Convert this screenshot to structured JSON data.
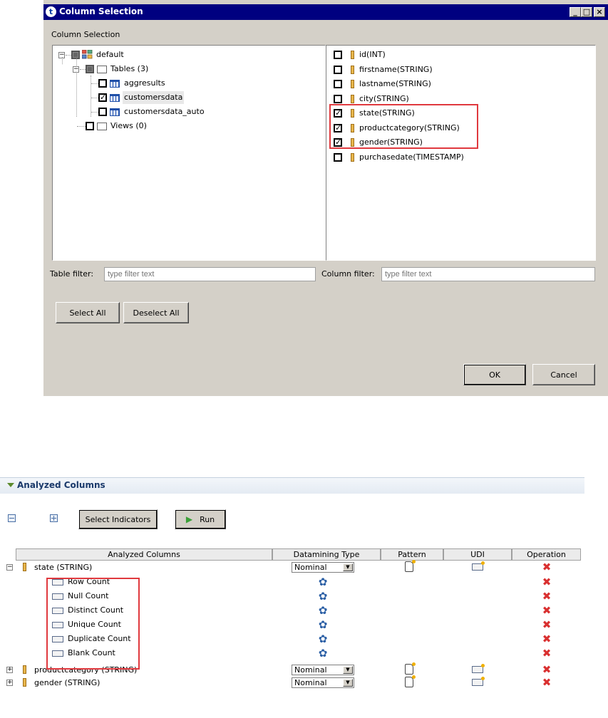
{
  "dialog": {
    "title": "Column Selection",
    "title_icon_glyph": "t",
    "section_label": "Column Selection",
    "window_buttons": {
      "minimize": "_",
      "maximize": "□",
      "close": "×"
    },
    "tree": {
      "root": "default",
      "tables_folder": "Tables (3)",
      "tables": [
        "aggresults",
        "customersdata",
        "customersdata_auto"
      ],
      "views_folder": "Views (0)"
    },
    "columns": [
      {
        "label": "id(INT)",
        "checked": false
      },
      {
        "label": "firstname(STRING)",
        "checked": false
      },
      {
        "label": "lastname(STRING)",
        "checked": false
      },
      {
        "label": "city(STRING)",
        "checked": false
      },
      {
        "label": "state(STRING)",
        "checked": true
      },
      {
        "label": "productcategory(STRING)",
        "checked": true
      },
      {
        "label": "gender(STRING)",
        "checked": true
      },
      {
        "label": "purchasedate(TIMESTAMP)",
        "checked": false
      }
    ],
    "table_filter": {
      "label": "Table filter:",
      "placeholder": "type filter text"
    },
    "column_filter": {
      "label": "Column filter:",
      "placeholder": "type filter text"
    },
    "select_all": "Select All",
    "deselect_all": "Deselect All",
    "ok": "OK",
    "cancel": "Cancel",
    "check_mark": "✓"
  },
  "analyzed": {
    "section_title": "Analyzed Columns",
    "select_indicators": "Select Indicators",
    "run": "Run",
    "headers": {
      "analyzed_columns": "Analyzed Columns",
      "datamining_type": "Datamining Type",
      "pattern": "Pattern",
      "udi": "UDI",
      "operation": "Operation"
    },
    "rows": [
      {
        "name": "state (STRING)",
        "type": "Nominal",
        "expander": "−"
      },
      {
        "name": "productcategory (STRING)",
        "type": "Nominal",
        "expander": "+"
      },
      {
        "name": "gender (STRING)",
        "type": "Nominal",
        "expander": "+"
      }
    ],
    "indicators": [
      "Row Count",
      "Null Count",
      "Distinct Count",
      "Unique Count",
      "Duplicate Count",
      "Blank Count"
    ],
    "glyphs": {
      "delete": "✖",
      "gear": "✿",
      "dropdown": "▼",
      "collapse": "⊟",
      "expand": "⊞"
    }
  },
  "colors": {
    "highlight_red": "#e0393e",
    "title_bar": "#000080"
  }
}
